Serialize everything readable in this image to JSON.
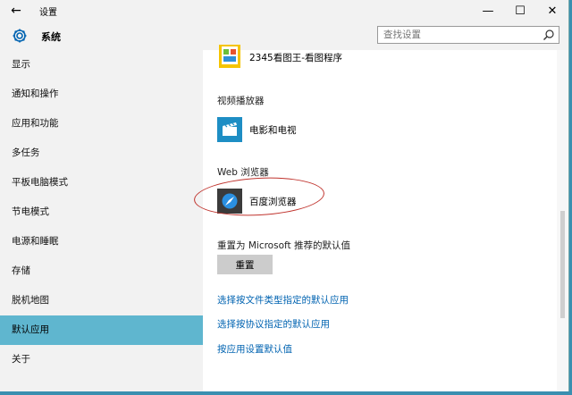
{
  "window": {
    "title": "设置",
    "back_glyph": "←",
    "minimize_glyph": "—",
    "maximize_glyph": "☐",
    "close_glyph": "✕"
  },
  "header": {
    "section_title": "系统",
    "search_placeholder": "查找设置"
  },
  "sidebar": {
    "items": [
      {
        "label": "显示"
      },
      {
        "label": "通知和操作"
      },
      {
        "label": "应用和功能"
      },
      {
        "label": "多任务"
      },
      {
        "label": "平板电脑模式"
      },
      {
        "label": "节电模式"
      },
      {
        "label": "电源和睡眠"
      },
      {
        "label": "存储"
      },
      {
        "label": "脱机地图"
      },
      {
        "label": "默认应用",
        "active": true
      },
      {
        "label": "关于"
      }
    ]
  },
  "content": {
    "photo_viewer_app": "2345看图王-看图程序",
    "video_label": "视频播放器",
    "video_app": "电影和电视",
    "browser_label": "Web 浏览器",
    "browser_app": "百度浏览器",
    "reset_label": "重置为 Microsoft 推荐的默认值",
    "reset_button": "重置",
    "links": [
      "选择按文件类型指定的默认应用",
      "选择按协议指定的默认应用",
      "按应用设置默认值"
    ]
  },
  "colors": {
    "accent": "#0063b1",
    "active_item": "#5fb6cf",
    "annotation": "#c0342e"
  }
}
